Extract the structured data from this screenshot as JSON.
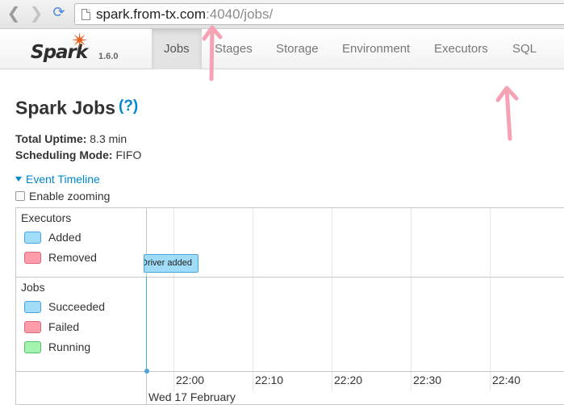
{
  "browser": {
    "url_host": "spark.from-tx.com",
    "url_port_path": ":4040/jobs/"
  },
  "navbar": {
    "logo_text": "Spark",
    "version": "1.6.0",
    "tabs": [
      {
        "label": "Jobs",
        "active": true
      },
      {
        "label": "Stages",
        "active": false
      },
      {
        "label": "Storage",
        "active": false
      },
      {
        "label": "Environment",
        "active": false
      },
      {
        "label": "Executors",
        "active": false
      },
      {
        "label": "SQL",
        "active": false
      }
    ]
  },
  "page": {
    "title": "Spark Jobs",
    "help": "(?)",
    "uptime_label": "Total Uptime:",
    "uptime_value": "8.3 min",
    "mode_label": "Scheduling Mode:",
    "mode_value": "FIFO",
    "timeline_toggle": "Event Timeline",
    "zoom_label": "Enable zooming"
  },
  "timeline": {
    "executors_title": "Executors",
    "executors_legend": [
      {
        "label": "Added",
        "color": "#a0dcf8"
      },
      {
        "label": "Removed",
        "color": "#ff9caa"
      }
    ],
    "jobs_title": "Jobs",
    "jobs_legend": [
      {
        "label": "Succeeded",
        "color": "#a0dcf8"
      },
      {
        "label": "Failed",
        "color": "#ff9caa"
      },
      {
        "label": "Running",
        "color": "#a4f2b0"
      }
    ],
    "event_label": "Driver added",
    "ticks": [
      "22:00",
      "22:10",
      "22:20",
      "22:30",
      "22:40"
    ],
    "date": "Wed 17 February"
  },
  "annotation_color": "#f4a2b4"
}
